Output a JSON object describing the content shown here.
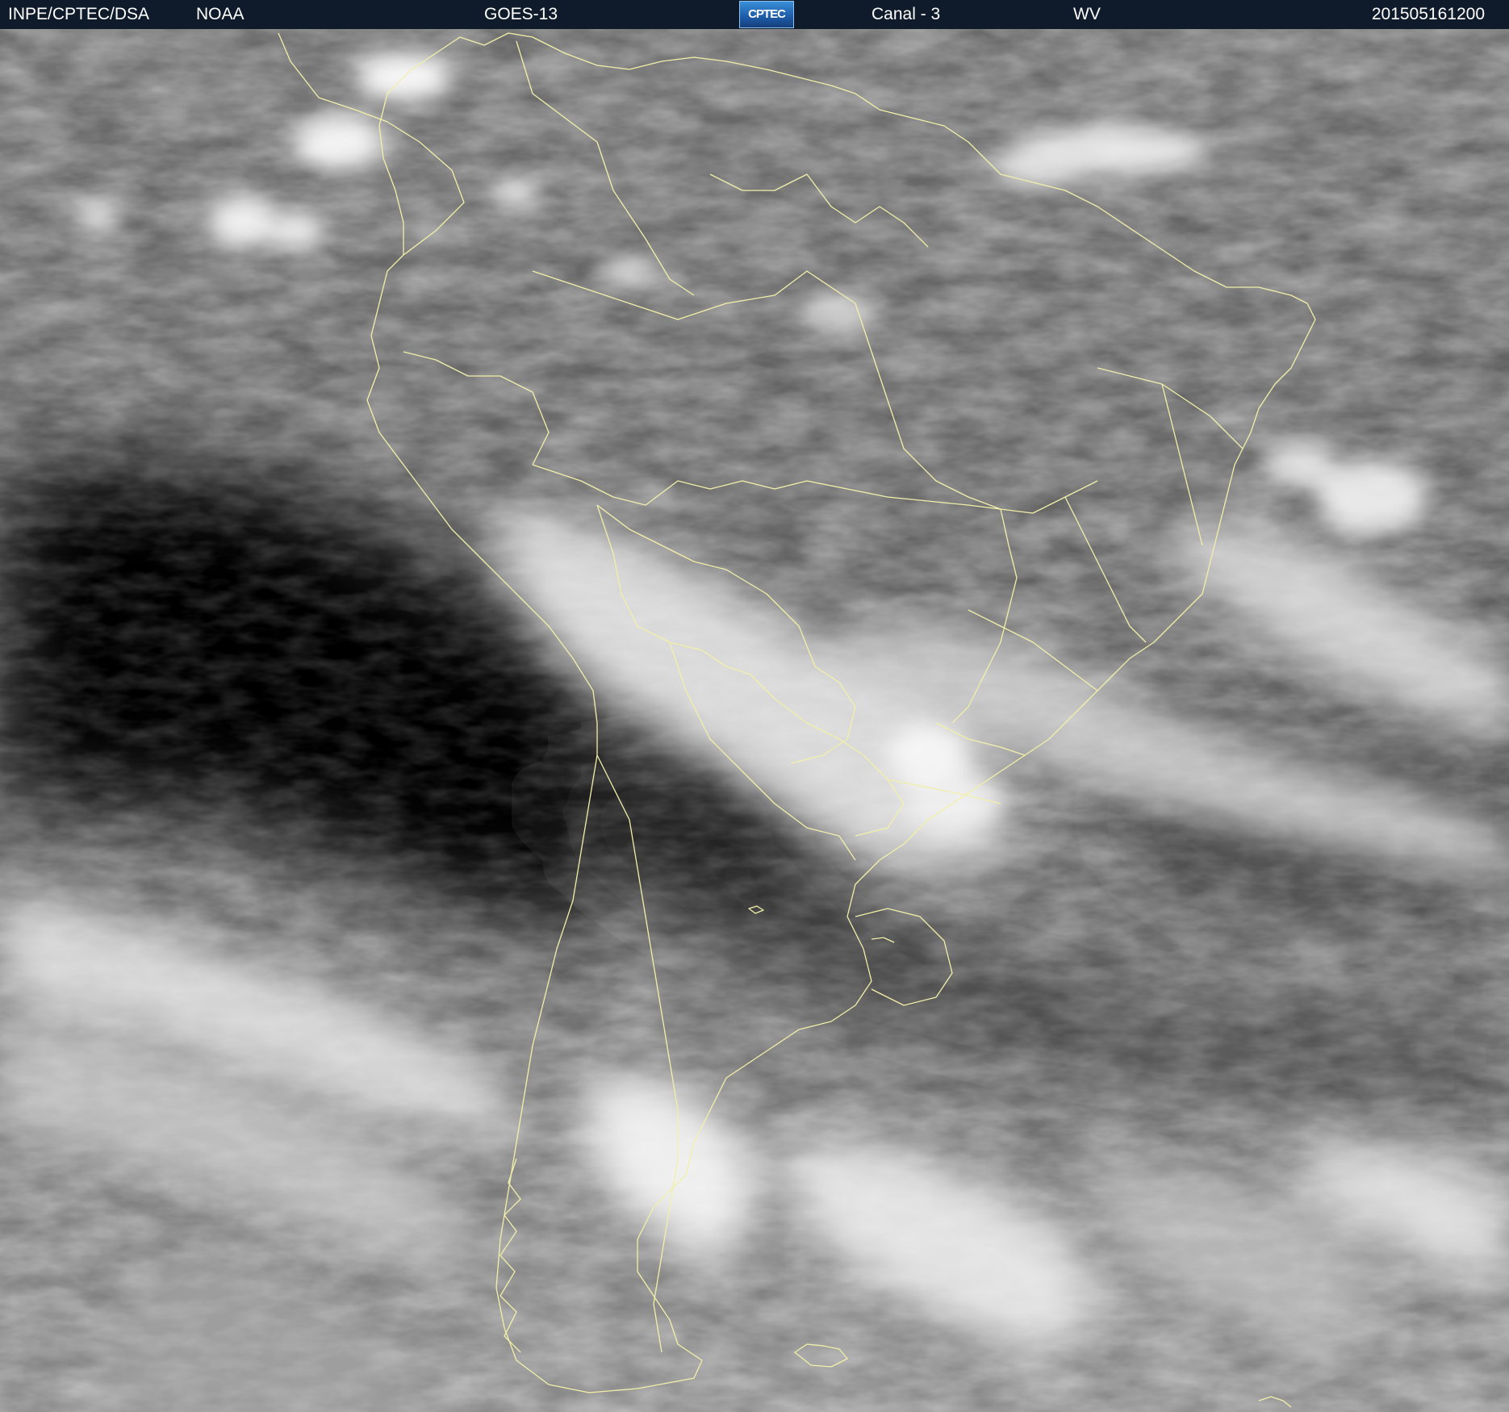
{
  "header": {
    "organization": "INPE/CPTEC/DSA",
    "agency": "NOAA",
    "satellite": "GOES-13",
    "logo_text": "CPTEC",
    "channel": "Canal - 3",
    "band": "WV",
    "timestamp": "201505161200"
  },
  "colors": {
    "header_background": "#0f1b2b",
    "header_text": "#ffffff",
    "border_lines": "#f2f0a8"
  },
  "imagery": {
    "type": "grayscale water vapor satellite image",
    "region": "South America"
  }
}
